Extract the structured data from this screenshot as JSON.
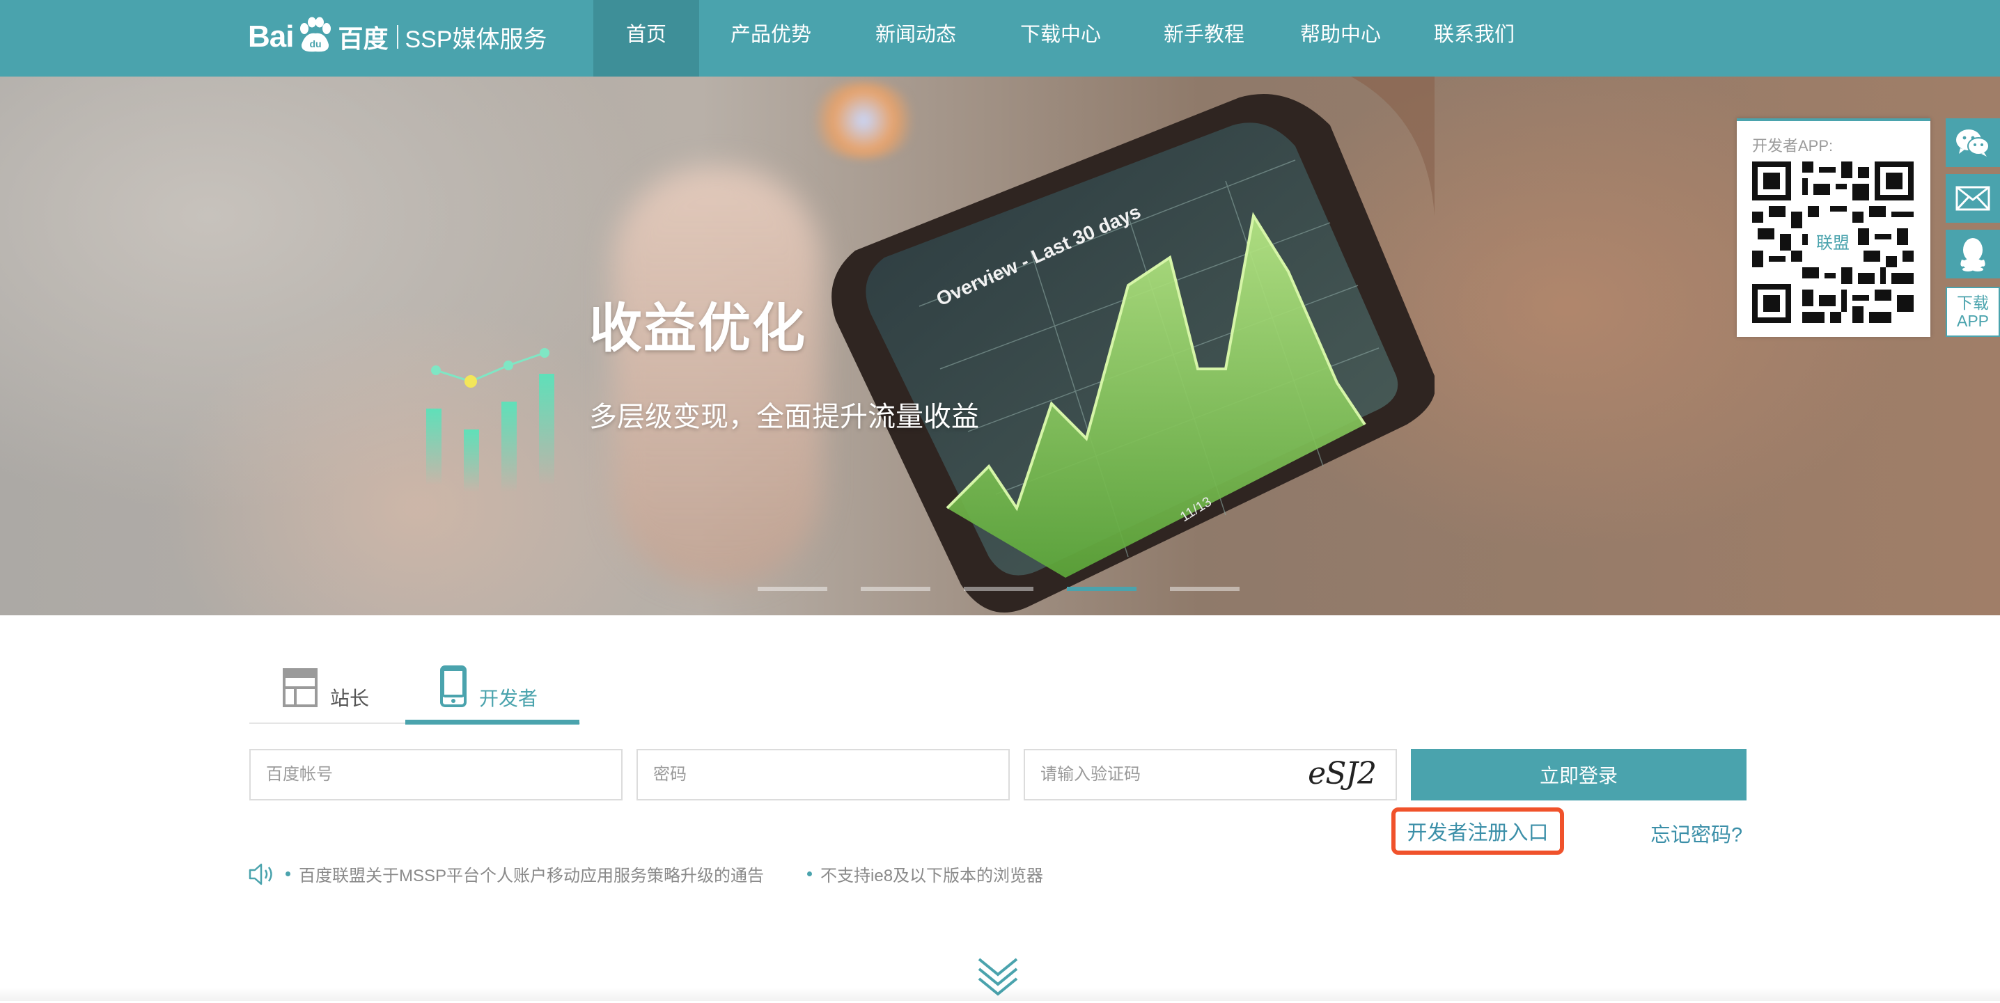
{
  "brand": {
    "logo_bai": "Bai",
    "logo_du": "du",
    "logo_cn": "百度",
    "product": "SSP媒体服务"
  },
  "nav": {
    "items": [
      {
        "label": "首页",
        "active": true
      },
      {
        "label": "产品优势",
        "active": false
      },
      {
        "label": "新闻动态",
        "active": false
      },
      {
        "label": "下载中心",
        "active": false
      },
      {
        "label": "新手教程",
        "active": false
      },
      {
        "label": "帮助中心",
        "active": false
      },
      {
        "label": "联系我们",
        "active": false
      }
    ]
  },
  "banner": {
    "title": "收益优化",
    "subtitle": "多层级变现，全面提升流量收益",
    "phone_screen_title": "Overview - Last 30 days",
    "phone_date_label": "11/13",
    "active_slide": 4,
    "slide_count": 5
  },
  "side_panel": {
    "qr_label": "开发者APP:",
    "qr_center_text": "联盟",
    "icons": [
      "wechat-icon",
      "mail-icon",
      "qq-icon"
    ],
    "download_label_line1": "下载",
    "download_label_line2": "APP"
  },
  "login": {
    "tabs": [
      {
        "label": "站长",
        "icon": "webmaster-icon",
        "active": false
      },
      {
        "label": "开发者",
        "icon": "mobile-icon",
        "active": true
      }
    ],
    "account_placeholder": "百度帐号",
    "password_placeholder": "密码",
    "captcha_placeholder": "请输入验证码",
    "captcha_text": "eSJ2",
    "submit_label": "立即登录",
    "register_label": "开发者注册入口",
    "forgot_label": "忘记密码?"
  },
  "notices": [
    "百度联盟关于MSSP平台个人账户移动应用服务策略升级的通告",
    "不支持ie8及以下版本的浏览器"
  ],
  "colors": {
    "primary": "#4aa3ad",
    "nav_active": "#3e8f98",
    "link": "#3b8fa8",
    "highlight_border": "#f0522b"
  }
}
